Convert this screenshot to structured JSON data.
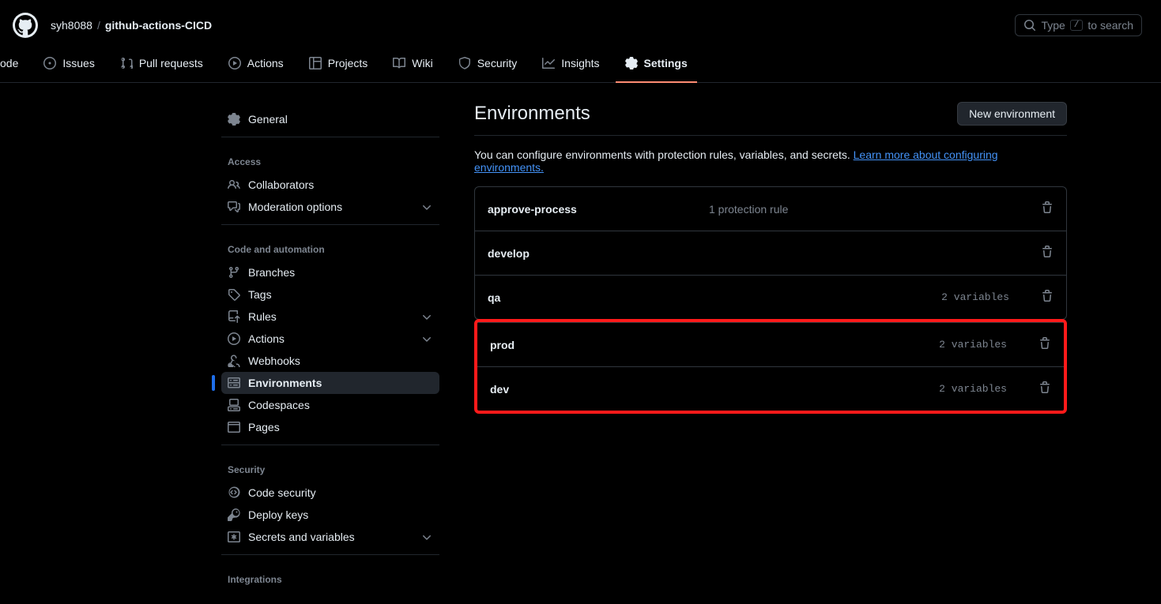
{
  "header": {
    "owner": "syh8088",
    "repo": "github-actions-CICD",
    "search_prefix": "Type",
    "search_key": "/",
    "search_suffix": "to search"
  },
  "repo_nav": {
    "code": "ode",
    "issues": "Issues",
    "pull_requests": "Pull requests",
    "actions": "Actions",
    "projects": "Projects",
    "wiki": "Wiki",
    "security": "Security",
    "insights": "Insights",
    "settings": "Settings"
  },
  "sidebar": {
    "general": "General",
    "access": {
      "title": "Access",
      "collaborators": "Collaborators",
      "moderation": "Moderation options"
    },
    "code_automation": {
      "title": "Code and automation",
      "branches": "Branches",
      "tags": "Tags",
      "rules": "Rules",
      "actions": "Actions",
      "webhooks": "Webhooks",
      "environments": "Environments",
      "codespaces": "Codespaces",
      "pages": "Pages"
    },
    "security": {
      "title": "Security",
      "code_security": "Code security",
      "deploy_keys": "Deploy keys",
      "secrets_vars": "Secrets and variables"
    },
    "integrations": {
      "title": "Integrations"
    }
  },
  "main": {
    "title": "Environments",
    "new_button": "New environment",
    "desc_text": "You can configure environments with protection rules, variables, and secrets. ",
    "desc_link": "Learn more about configuring environments.",
    "envs": [
      {
        "name": "approve-process",
        "meta": "1 protection rule",
        "vars": ""
      },
      {
        "name": "develop",
        "meta": "",
        "vars": ""
      },
      {
        "name": "qa",
        "meta": "",
        "vars": "2 variables"
      },
      {
        "name": "prod",
        "meta": "",
        "vars": "2 variables"
      },
      {
        "name": "dev",
        "meta": "",
        "vars": "2 variables"
      }
    ]
  }
}
